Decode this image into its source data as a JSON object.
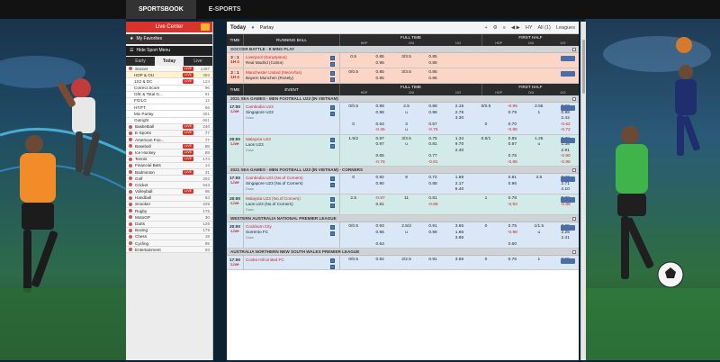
{
  "top_nav": {
    "tabs": [
      {
        "label": "SPORTSBOOK",
        "active": true
      },
      {
        "label": "E-SPORTS",
        "active": false
      }
    ]
  },
  "sidebar": {
    "live_center": "Live Center",
    "my_favorites": "My Favorites",
    "hide_menu": "Hide Sport Menu",
    "tabs": [
      {
        "label": "Early",
        "active": false
      },
      {
        "label": "Today",
        "active": true
      },
      {
        "label": "Live",
        "active": false
      }
    ],
    "items": [
      {
        "label": "Soccer",
        "live": "LIVE",
        "count": "1497",
        "sub": false,
        "sel": false
      },
      {
        "label": "HDP & OU",
        "live": "LIVE",
        "count": "393",
        "sub": true,
        "sel": true
      },
      {
        "label": "1X2 & DC",
        "live": "LIVE",
        "count": "124",
        "sub": true,
        "sel": false
      },
      {
        "label": "Correct Score",
        "live": "",
        "count": "96",
        "sub": true,
        "sel": false
      },
      {
        "label": "O/E & Total G...",
        "live": "",
        "count": "91",
        "sub": true,
        "sel": false
      },
      {
        "label": "FG/LG",
        "live": "",
        "count": "12",
        "sub": true,
        "sel": false
      },
      {
        "label": "HT/FT",
        "live": "",
        "count": "66",
        "sub": true,
        "sel": false
      },
      {
        "label": "Mix Parlay",
        "live": "",
        "count": "301",
        "sub": true,
        "sel": false
      },
      {
        "label": "Outright",
        "live": "",
        "count": "651",
        "sub": true,
        "sel": false
      },
      {
        "label": "Basketball",
        "live": "LIVE",
        "count": "240",
        "sub": false,
        "sel": false
      },
      {
        "label": "E-Sports",
        "live": "LIVE",
        "count": "77",
        "sub": false,
        "sel": false
      },
      {
        "label": "American Foo...",
        "live": "",
        "count": "77",
        "sub": false,
        "sel": false
      },
      {
        "label": "Baseball",
        "live": "LIVE",
        "count": "88",
        "sub": false,
        "sel": false
      },
      {
        "label": "Ice Hockey",
        "live": "LIVE",
        "count": "88",
        "sub": false,
        "sel": false
      },
      {
        "label": "Tennis",
        "live": "LIVE",
        "count": "174",
        "sub": false,
        "sel": false
      },
      {
        "label": "Financial Bets",
        "live": "",
        "count": "14",
        "sub": false,
        "sel": false
      },
      {
        "label": "Badminton",
        "live": "LIVE",
        "count": "31",
        "sub": false,
        "sel": false
      },
      {
        "label": "Golf",
        "live": "",
        "count": "202",
        "sub": false,
        "sel": false
      },
      {
        "label": "Cricket",
        "live": "",
        "count": "643",
        "sub": false,
        "sel": false
      },
      {
        "label": "Volleyball",
        "live": "LIVE",
        "count": "95",
        "sub": false,
        "sel": false
      },
      {
        "label": "Handball",
        "live": "",
        "count": "63",
        "sub": false,
        "sel": false
      },
      {
        "label": "Snooker",
        "live": "",
        "count": "229",
        "sub": false,
        "sel": false
      },
      {
        "label": "Rugby",
        "live": "",
        "count": "175",
        "sub": false,
        "sel": false
      },
      {
        "label": "MotoGP",
        "live": "",
        "count": "30",
        "sub": false,
        "sel": false
      },
      {
        "label": "Darts",
        "live": "",
        "count": "126",
        "sub": false,
        "sel": false
      },
      {
        "label": "Boxing",
        "live": "",
        "count": "179",
        "sub": false,
        "sel": false
      },
      {
        "label": "Chess",
        "live": "",
        "count": "19",
        "sub": false,
        "sel": false
      },
      {
        "label": "Cycling",
        "live": "",
        "count": "99",
        "sub": false,
        "sel": false
      },
      {
        "label": "Entertainment",
        "live": "",
        "count": "93",
        "sub": false,
        "sel": false
      }
    ]
  },
  "toolbar": {
    "today": "Today",
    "parlay": "Parlay",
    "controls": [
      "+",
      "⚙",
      "≡",
      "◀ ▶",
      "HY",
      "All (1)",
      "Leagues"
    ]
  },
  "running_header": {
    "time": "TIME",
    "event": "RUNNING BALL",
    "full": "FULL TIME",
    "half": "FIRST HALF",
    "full_sub": [
      "HDP",
      "O/U",
      "1X2"
    ],
    "half_sub": [
      "HDP",
      "O/U",
      "1X2"
    ]
  },
  "event_header": {
    "time": "TIME",
    "event": "EVENT",
    "full": "FULL TIME",
    "half": "FIRST HALF",
    "full_sub": [
      "HDP",
      "O/U",
      "1X2"
    ],
    "half_sub": [
      "HDP",
      "O/U",
      "1X2"
    ]
  },
  "running_leagues": [
    {
      "name": "SOCCER BATTLE - 8 MINS PLAY",
      "matches": [
        {
          "time": "2 : 1",
          "time2": "1H 4",
          "home": "Liverpool (Sonyspans)",
          "away": "Real Madrid (Cobra)",
          "draw": "",
          "color": "orange",
          "rows": [
            [
              "0.5",
              "0.85",
              "3/3.5",
              "0.85",
              "",
              "",
              "",
              "",
              ""
            ],
            [
              "",
              "0.95",
              "",
              "0.85",
              "",
              "",
              "",
              "",
              ""
            ]
          ]
        },
        {
          "time": "2 : 1",
          "time2": "1H 4",
          "home": "Manchester United (NeoArfos)",
          "away": "Bayern Munchen (Rosely)",
          "draw": "",
          "color": "orange",
          "rows": [
            [
              "0/0.5",
              "0.85",
              "3/3.5",
              "0.85",
              "",
              "",
              "",
              "",
              ""
            ],
            [
              "",
              "0.95",
              "",
              "0.85",
              "",
              "",
              "",
              "",
              ""
            ]
          ]
        }
      ]
    }
  ],
  "event_leagues": [
    {
      "name": "2021 SEA GAMES - MEN FOOTBALL U23 (IN VIETNAM)",
      "matches": [
        {
          "time": "17:00",
          "time2": "Live",
          "home": "Cambodia U23",
          "away": "Singapore U23",
          "draw": "Draw",
          "color": "blue",
          "rows": [
            [
              "0/0.5",
              "0.88",
              "2.5",
              "0.88",
              "2.15",
              "0/0.5",
              "-0.95",
              "2.55",
              "0.82"
            ],
            [
              "",
              "0.98",
              "u",
              "0.98",
              "2.76",
              "",
              "0.79",
              "1",
              "0.98"
            ],
            [
              "",
              "",
              "",
              "",
              "3.30",
              "",
              "",
              "",
              "2.42"
            ],
            [
              "0",
              "0.63",
              "3",
              "0.57",
              "",
              "0",
              "0.70",
              "",
              "-0.62"
            ],
            [
              "",
              "-0.45",
              "u",
              "-0.75",
              "",
              "",
              "-0.86",
              "",
              "-0.72"
            ]
          ]
        },
        {
          "time": "20:00",
          "time2": "Live",
          "home": "Malaysia U23",
          "away": "Laos U23",
          "draw": "Draw",
          "color": "teal",
          "rows": [
            [
              "1.5/2",
              "0.87",
              "3/3.5",
              "0.75",
              "1.34",
              "0.5/1",
              "0.85",
              "1.25",
              "0.78"
            ],
            [
              "",
              "0.97",
              "u",
              "0.81",
              "9.70",
              "",
              "0.97",
              "u",
              "1.38"
            ],
            [
              "",
              "",
              "",
              "",
              "2.40",
              "",
              "",
              "",
              "2.91"
            ],
            [
              "",
              "0.65",
              "",
              "0.77",
              "",
              "",
              "0.76",
              "",
              "-0.90"
            ],
            [
              "",
              "-0.76",
              "",
              "-0.91",
              "",
              "",
              "-0.86",
              "",
              "-0.98"
            ]
          ]
        }
      ]
    },
    {
      "name": "2021 SEA GAMES - MEN FOOTBALL U23 (IN VIETNAM) - CORNERS",
      "matches": [
        {
          "time": "17:00",
          "time2": "Live",
          "home": "Cambodia U23 (No.of Corners)",
          "away": "Singapore U23 (No.of Corners)",
          "draw": "Draw",
          "color": "blue",
          "rows": [
            [
              "0",
              "0.92",
              "9",
              "0.72",
              "1.88",
              "",
              "0.81",
              "3.5",
              "2.42"
            ],
            [
              "",
              "0.90",
              "",
              "0.88",
              "2.17",
              "",
              "0.96",
              "",
              "2.71"
            ],
            [
              "",
              "",
              "",
              "",
              "6.40",
              "",
              "",
              "",
              "4.10"
            ]
          ]
        },
        {
          "time": "20:00",
          "time2": "Live",
          "home": "Malaysia U23 (No.of Corners)",
          "away": "Laos U23 (No.of Corners)",
          "draw": "Draw",
          "color": "teal",
          "rows": [
            [
              "2.5",
              "-0.97",
              "11",
              "0.81",
              "",
              "1",
              "0.78",
              "",
              "0.78"
            ],
            [
              "",
              "0.81",
              "",
              "-0.98",
              "",
              "",
              "-0.93",
              "",
              "-0.98"
            ]
          ]
        }
      ]
    },
    {
      "name": "WESTERN AUSTRALIA NATIONAL PREMIER LEAGUE",
      "matches": [
        {
          "time": "20:00",
          "time2": "Live",
          "home": "Cockburn City",
          "away": "Sorrento FC",
          "draw": "Draw",
          "color": "blue",
          "rows": [
            [
              "0/0.5",
              "0.93",
              "2.5/3",
              "0.91",
              "3.65",
              "0",
              "0.75",
              "1/1.5",
              "3.65"
            ],
            [
              "",
              "0.96",
              "u",
              "0.98",
              "1.86",
              "",
              "-0.98",
              "u",
              "2.25"
            ],
            [
              "",
              "",
              "",
              "",
              "3.86",
              "",
              "",
              "",
              "2.41"
            ],
            [
              "",
              "0.63",
              "",
              "",
              "",
              "",
              "0.60",
              "",
              ""
            ]
          ]
        }
      ]
    },
    {
      "name": "AUSTRALIA NORTHERN NEW SOUTH WALES PREMIER LEAGUE",
      "matches": [
        {
          "time": "17:00",
          "time2": "Live",
          "home": "Cooks Hill United FC",
          "away": "",
          "draw": "",
          "color": "blue",
          "rows": [
            [
              "0/0.5",
              "0.92",
              "2/2.5",
              "0.91",
              "3.65",
              "0",
              "0.76",
              "1",
              "3.65"
            ]
          ]
        }
      ]
    }
  ]
}
